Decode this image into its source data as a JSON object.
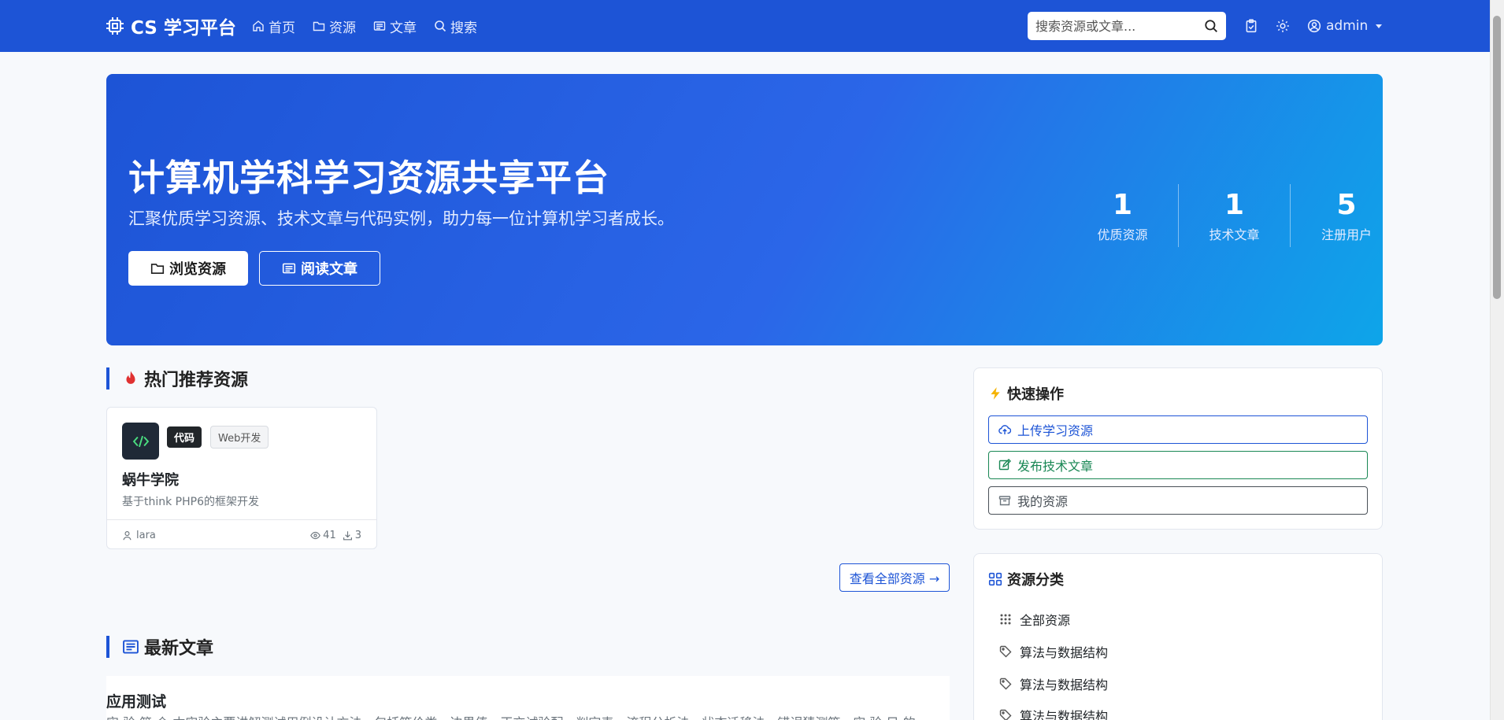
{
  "nav": {
    "brand": "CS 学习平台",
    "links": [
      {
        "label": "首页",
        "icon": "house-icon"
      },
      {
        "label": "资源",
        "icon": "folder-icon"
      },
      {
        "label": "文章",
        "icon": "newspaper-icon"
      },
      {
        "label": "搜索",
        "icon": "search-icon"
      }
    ],
    "search_placeholder": "搜索资源或文章...",
    "user": "admin"
  },
  "hero": {
    "title": "计算机学科学习资源共享平台",
    "subtitle": "汇聚优质学习资源、技术文章与代码实例，助力每一位计算机学习者成长。",
    "btn_browse": "浏览资源",
    "btn_read": "阅读文章",
    "stats": [
      {
        "num": "1",
        "label": "优质资源"
      },
      {
        "num": "1",
        "label": "技术文章"
      },
      {
        "num": "5",
        "label": "注册用户"
      }
    ]
  },
  "hot": {
    "heading": "热门推荐资源",
    "card": {
      "badge_type": "代码",
      "badge_tag": "Web开发",
      "title": "蜗牛学院",
      "desc": "基于think PHP6的框架开发",
      "author": "lara",
      "views": "41",
      "downloads": "3"
    },
    "view_all": "查看全部资源 →"
  },
  "latest": {
    "heading": "最新文章",
    "article_title": "应用测试",
    "article_desc": "实 验 简 介 本实验主要讲解测试用例设计方法，包括等价类、边界值、正交试验配、判定表、流程分析法、状态迁移法、错误猜测等。实 验 目 的"
  },
  "quick": {
    "heading": "快速操作",
    "upload": "上传学习资源",
    "publish": "发布技术文章",
    "mine": "我的资源"
  },
  "categories": {
    "heading": "资源分类",
    "items": [
      "全部资源",
      "算法与数据结构",
      "算法与数据结构",
      "算法与数据结构"
    ]
  },
  "colors": {
    "primary": "#1d54d6",
    "success": "#198754",
    "accent": "#0ea5e9"
  }
}
